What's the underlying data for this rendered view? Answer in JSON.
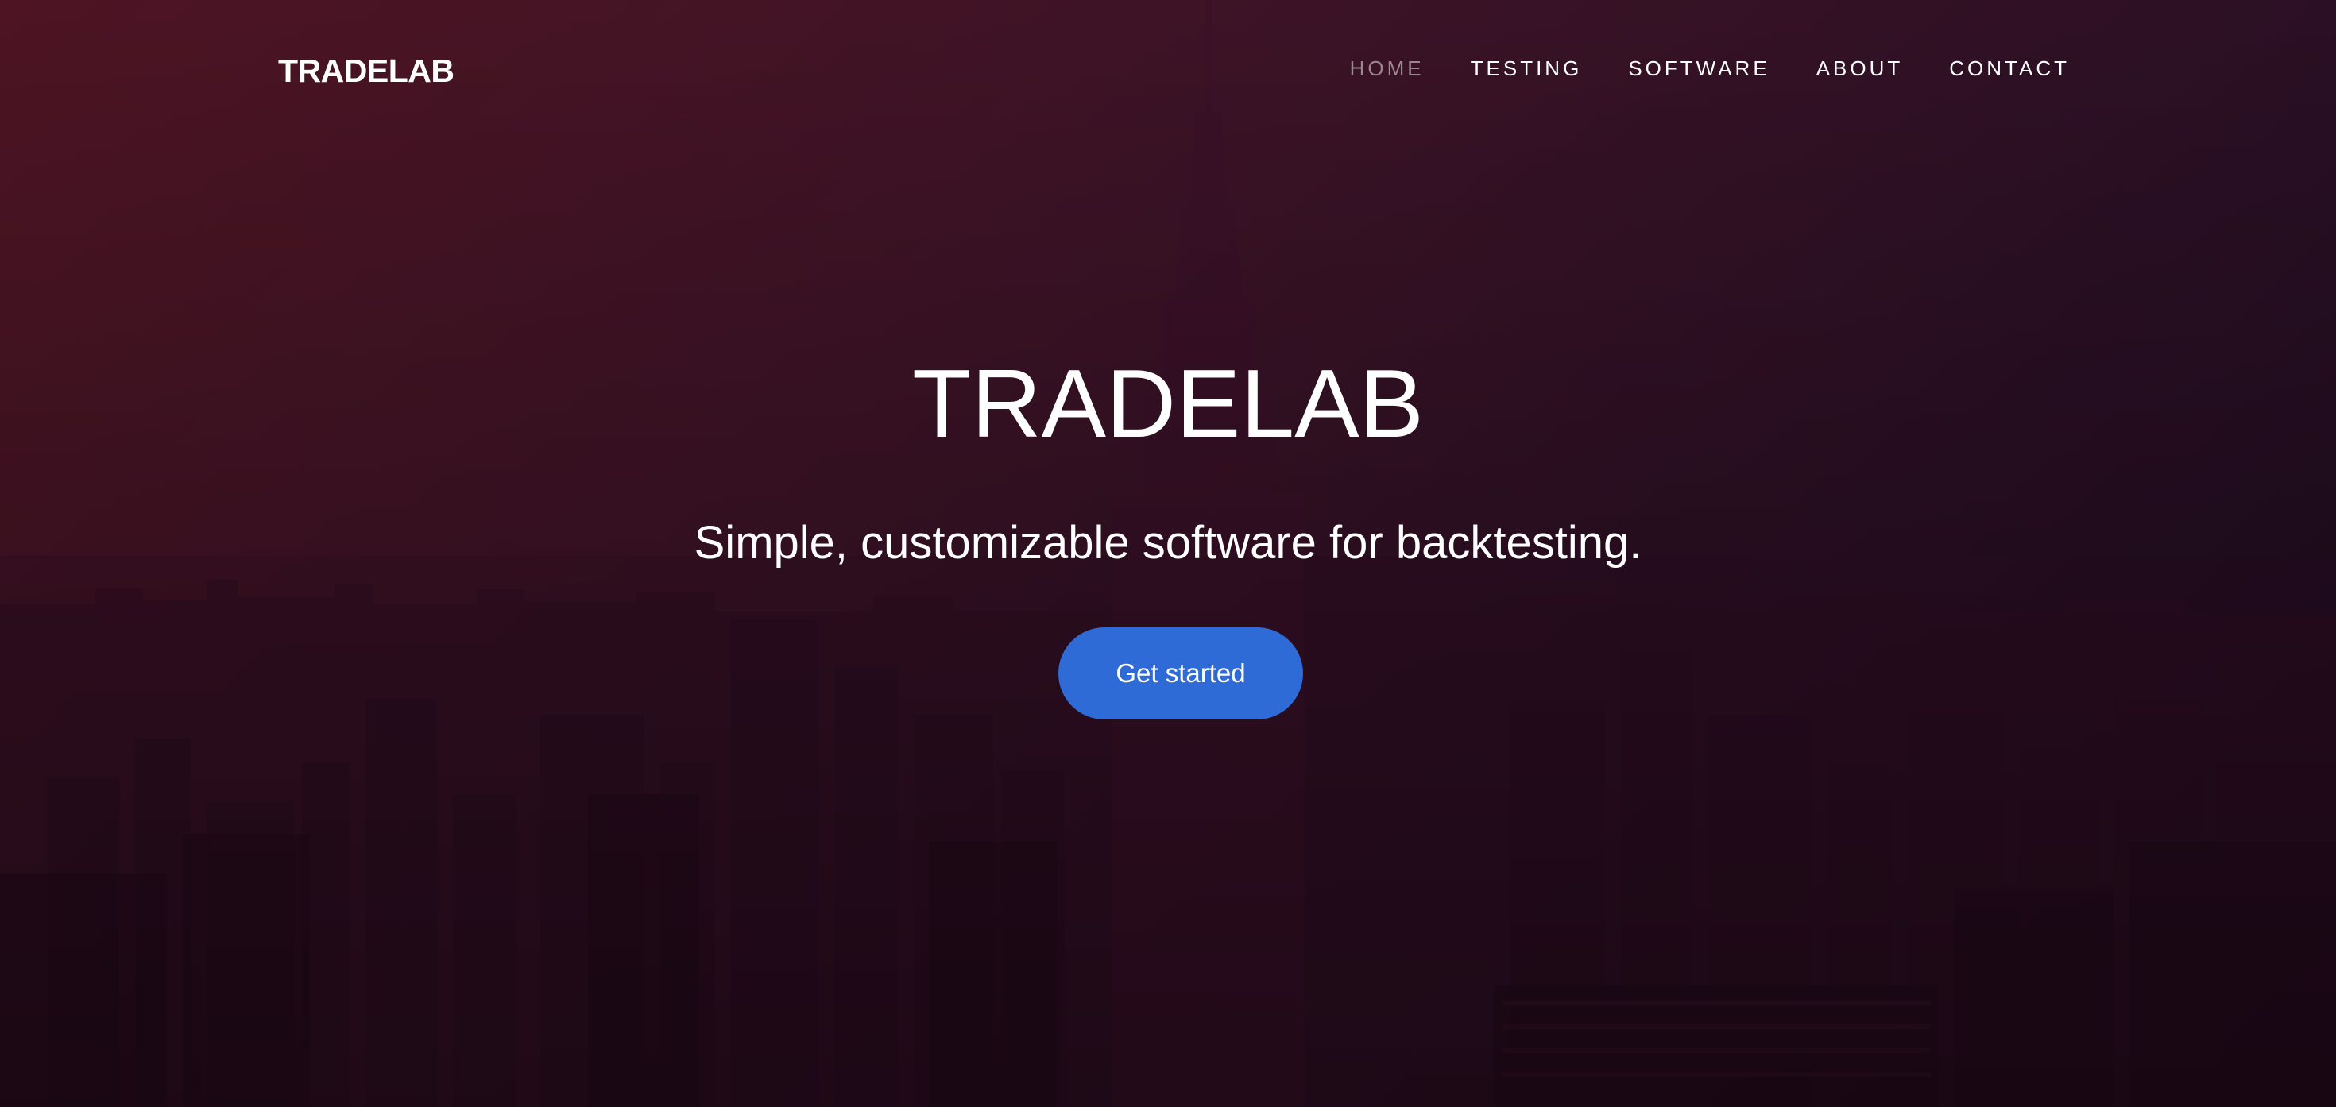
{
  "brand": {
    "name": "TRADELAB"
  },
  "nav": {
    "items": [
      {
        "label": "HOME",
        "active": true
      },
      {
        "label": "TESTING",
        "active": false
      },
      {
        "label": "SOFTWARE",
        "active": false
      },
      {
        "label": "ABOUT",
        "active": false
      },
      {
        "label": "CONTACT",
        "active": false
      }
    ]
  },
  "hero": {
    "title": "TRADELAB",
    "subtitle": "Simple, customizable software for backtesting.",
    "cta_label": "Get started",
    "background_image": "city-skyline"
  },
  "colors": {
    "gradient_start": "#4e1423",
    "gradient_end": "#1a0b1f",
    "cta": "#2f6bd6",
    "nav_active": "#9b8790",
    "text": "#ffffff"
  }
}
